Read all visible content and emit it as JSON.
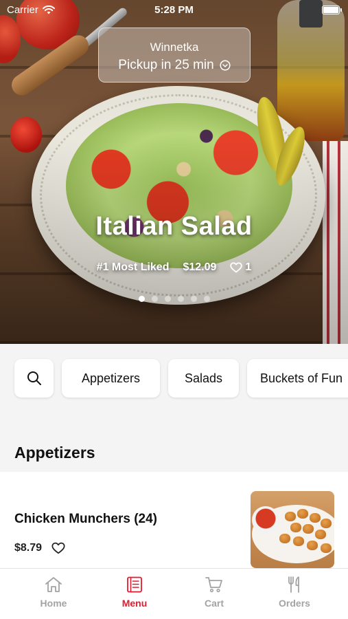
{
  "status_bar": {
    "carrier": "Carrier",
    "time": "5:28 PM"
  },
  "location": {
    "city": "Winnetka",
    "pickup": "Pickup in 25 min"
  },
  "featured": {
    "name": "Italian Salad",
    "tag": "#1 Most Liked",
    "price": "$12.09",
    "likes": "1",
    "carousel": {
      "count": 6,
      "active_index": 0
    }
  },
  "categories": {
    "items": [
      "Appetizers",
      "Salads",
      "Buckets of Fun"
    ],
    "search_icon": "search-icon"
  },
  "section": {
    "title": "Appetizers"
  },
  "menu_items": [
    {
      "name": "Chicken Munchers (24)",
      "price": "$8.79",
      "liked": false
    }
  ],
  "tabbar": {
    "tabs": [
      {
        "label": "Home",
        "icon": "home-icon",
        "active": false
      },
      {
        "label": "Menu",
        "icon": "menu-icon",
        "active": true
      },
      {
        "label": "Cart",
        "icon": "cart-icon",
        "active": false
      },
      {
        "label": "Orders",
        "icon": "fork-knife-icon",
        "active": false
      }
    ],
    "active_color": "#e51a2c",
    "inactive_color": "#a3a3a3"
  }
}
